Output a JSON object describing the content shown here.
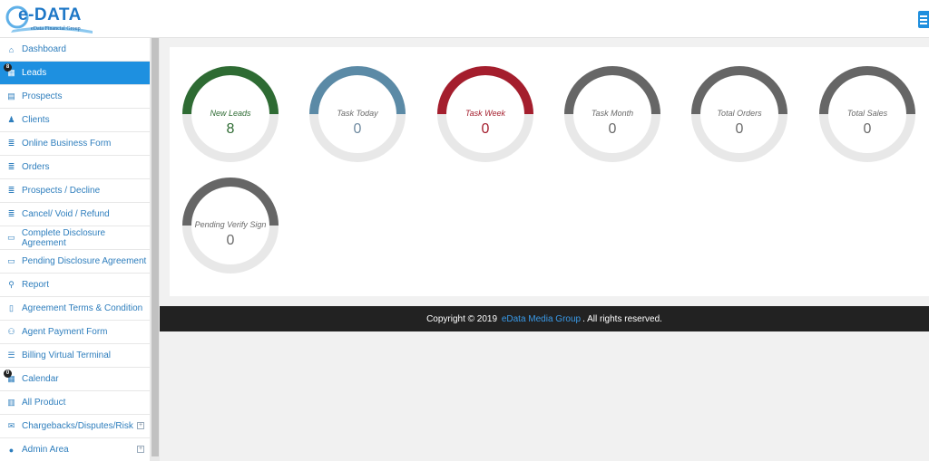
{
  "brand": {
    "name": "e-DATA",
    "subtitle": "eData Financial Group"
  },
  "sidebar": {
    "items": [
      {
        "label": "Dashboard",
        "icon": "home-icon"
      },
      {
        "label": "Leads",
        "icon": "chart-icon",
        "badge": "8",
        "active": true
      },
      {
        "label": "Prospects",
        "icon": "table-icon"
      },
      {
        "label": "Clients",
        "icon": "person-icon"
      },
      {
        "label": "Online Business Form",
        "icon": "database-icon"
      },
      {
        "label": "Orders",
        "icon": "database-icon"
      },
      {
        "label": "Prospects / Decline",
        "icon": "database-icon"
      },
      {
        "label": "Cancel/ Void / Refund",
        "icon": "database-icon"
      },
      {
        "label": "Complete Disclosure Agreement",
        "icon": "card-icon"
      },
      {
        "label": "Pending Disclosure Agreement",
        "icon": "card-icon"
      },
      {
        "label": "Report",
        "icon": "search-icon"
      },
      {
        "label": "Agreement Terms & Condition",
        "icon": "document-icon"
      },
      {
        "label": "Agent Payment Form",
        "icon": "users-icon"
      },
      {
        "label": "Billing Virtual Terminal",
        "icon": "list-icon"
      },
      {
        "label": "Calendar",
        "icon": "calendar-icon",
        "badge": "0"
      },
      {
        "label": "All Product",
        "icon": "columns-icon"
      },
      {
        "label": "Chargebacks/Disputes/Risk",
        "icon": "envelope-icon",
        "expandable": true
      },
      {
        "label": "Admin Area",
        "icon": "user-icon",
        "expandable": true
      }
    ]
  },
  "stats": [
    {
      "label": "New Leads",
      "value": "8",
      "arc_color": "#2e6b33",
      "label_color": "#2e6b33",
      "value_color": "#2e6b33",
      "fill": 1.0
    },
    {
      "label": "Task Today",
      "value": "0",
      "arc_color": "#5b8aa6",
      "label_color": "#6a6a6a",
      "value_color": "#6f8aa0",
      "fill": 1.0
    },
    {
      "label": "Task Week",
      "value": "0",
      "arc_color": "#a41e2d",
      "label_color": "#a41e2d",
      "value_color": "#a41e2d",
      "fill": 1.0
    },
    {
      "label": "Task Month",
      "value": "0",
      "arc_color": "#666666",
      "label_color": "#6a6a6a",
      "value_color": "#6a6a6a",
      "fill": 1.0
    },
    {
      "label": "Total Orders",
      "value": "0",
      "arc_color": "#666666",
      "label_color": "#6a6a6a",
      "value_color": "#6a6a6a",
      "fill": 1.0
    },
    {
      "label": "Total Sales",
      "value": "0",
      "arc_color": "#666666",
      "label_color": "#6a6a6a",
      "value_color": "#6a6a6a",
      "fill": 1.0
    },
    {
      "label": "Pending Verify Sign",
      "value": "0",
      "arc_color": "#666666",
      "label_color": "#6a6a6a",
      "value_color": "#6a6a6a",
      "fill": 1.0
    }
  ],
  "footer": {
    "prefix": "Copyright © 2019",
    "link": "eData Media Group",
    "suffix": ". All rights reserved."
  },
  "colors": {
    "accent": "#1e90e0",
    "track": "#e8e8e8"
  }
}
